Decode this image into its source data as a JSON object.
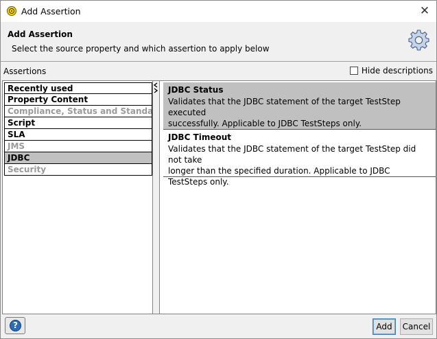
{
  "window": {
    "title": "Add Assertion",
    "close_glyph": "✕"
  },
  "banner": {
    "title": "Add Assertion",
    "description": "Select the source property and which assertion to apply below",
    "icon": "gear-icon"
  },
  "assertions_label": "Assertions",
  "hide_descriptions": {
    "label": "Hide descriptions",
    "checked": false
  },
  "categories": [
    {
      "label": "Recently used",
      "enabled": true,
      "selected": false
    },
    {
      "label": "Property Content",
      "enabled": true,
      "selected": false
    },
    {
      "label": "Compliance, Status and Standards",
      "enabled": false,
      "selected": false
    },
    {
      "label": "Script",
      "enabled": true,
      "selected": false
    },
    {
      "label": "SLA",
      "enabled": true,
      "selected": false
    },
    {
      "label": "JMS",
      "enabled": false,
      "selected": false
    },
    {
      "label": "JDBC",
      "enabled": true,
      "selected": true
    },
    {
      "label": "Security",
      "enabled": false,
      "selected": false
    }
  ],
  "assertions": [
    {
      "name": "JDBC Status",
      "description_lines": [
        "Validates that the JDBC statement of the target TestStep executed",
        "successfully. Applicable to JDBC TestSteps only."
      ],
      "selected": true
    },
    {
      "name": "JDBC Timeout",
      "description_lines": [
        "Validates that the JDBC statement of the target TestStep did not take",
        "longer than the specified duration. Applicable to JDBC TestSteps only."
      ],
      "selected": false
    }
  ],
  "footer": {
    "help_glyph": "?",
    "add_label": "Add",
    "cancel_label": "Cancel"
  },
  "colors": {
    "selection": "#c0c0c0",
    "disabled_text": "#9a9a9a",
    "help_blue": "#2c6db8"
  }
}
